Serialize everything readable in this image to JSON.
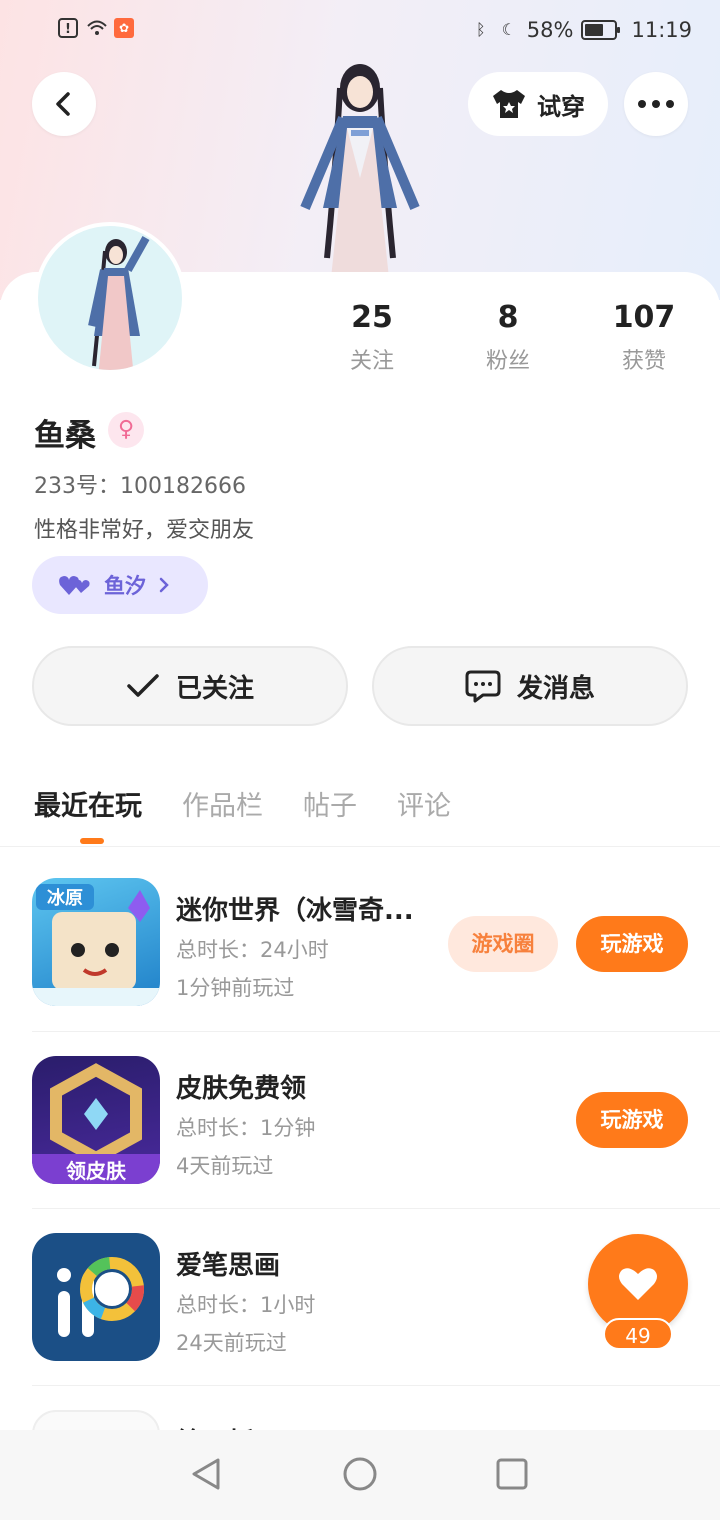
{
  "status_bar": {
    "battery": "58%",
    "time": "11:19"
  },
  "header": {
    "try_on_label": "试穿"
  },
  "profile": {
    "name": "鱼桑",
    "uid": "233号：100182666",
    "bio": "性格非常好，爱交朋友",
    "cp_name": "鱼汐",
    "stats": [
      {
        "value": "25",
        "label": "关注"
      },
      {
        "value": "8",
        "label": "粉丝"
      },
      {
        "value": "107",
        "label": "获赞"
      }
    ],
    "follow_label": "已关注",
    "message_label": "发消息"
  },
  "tabs": [
    "最近在玩",
    "作品栏",
    "帖子",
    "评论"
  ],
  "games": [
    {
      "name": "迷你世界（冰雪奇...",
      "duration": "总时长：24小时",
      "last_played": "1分钟前玩过",
      "circle_label": "游戏圈",
      "play_label": "玩游戏",
      "icon_text": "冰原"
    },
    {
      "name": "皮肤免费领",
      "duration": "总时长：1分钟",
      "last_played": "4天前玩过",
      "play_label": "玩游戏",
      "icon_text": "领皮肤"
    },
    {
      "name": "爱笔思画",
      "duration": "总时长：1小时",
      "last_played": "24天前玩过",
      "icon_text": "iP"
    },
    {
      "name": "绘画板"
    }
  ],
  "fab": {
    "count": "49"
  },
  "colors": {
    "accent": "#ff7a1a",
    "cp_purple": "#6c63d8"
  }
}
